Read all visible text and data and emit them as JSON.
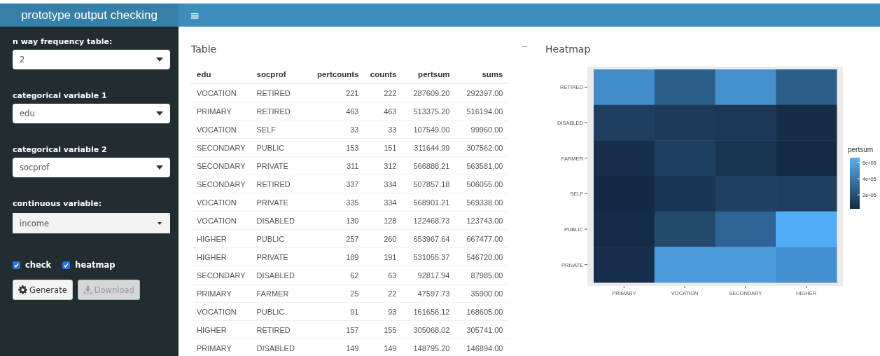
{
  "header": {
    "title": "prototype output checking",
    "menu_glyph": "≡"
  },
  "sidebar": {
    "fields": [
      {
        "label": "n way frequency table:",
        "value": "2",
        "kind": "select"
      },
      {
        "label": "categorical variable 1",
        "value": "edu",
        "kind": "select"
      },
      {
        "label": "categorical variable 2",
        "value": "socprof",
        "kind": "select"
      },
      {
        "label": "continuous variable:",
        "value": "income",
        "kind": "selectize"
      }
    ],
    "checkboxes": [
      {
        "label": "check",
        "checked": true
      },
      {
        "label": "heatmap",
        "checked": true
      }
    ],
    "buttons": [
      {
        "label": "Generate",
        "kind": "generate",
        "disabled": false
      },
      {
        "label": "Download",
        "kind": "download",
        "disabled": true
      }
    ]
  },
  "table_box": {
    "title": "Table",
    "collapse_glyph": "–",
    "columns": [
      "edu",
      "socprof",
      "pertcounts",
      "counts",
      "pertsum",
      "sums"
    ],
    "rows": [
      [
        "VOCATION",
        "RETIRED",
        "221",
        "222",
        "287609.20",
        "292397.00"
      ],
      [
        "PRIMARY",
        "RETIRED",
        "463",
        "463",
        "513375.20",
        "516194.00"
      ],
      [
        "VOCATION",
        "SELF",
        "33",
        "33",
        "107549.00",
        "99960.00"
      ],
      [
        "SECONDARY",
        "PUBLIC",
        "153",
        "151",
        "311644.99",
        "307562.00"
      ],
      [
        "SECONDARY",
        "PRIVATE",
        "311",
        "312",
        "566888.21",
        "563581.00"
      ],
      [
        "SECONDARY",
        "RETIRED",
        "337",
        "334",
        "507857.18",
        "506055.00"
      ],
      [
        "VOCATION",
        "PRIVATE",
        "335",
        "334",
        "568901.21",
        "569338.00"
      ],
      [
        "VOCATION",
        "DISABLED",
        "130",
        "128",
        "122468.73",
        "123743.00"
      ],
      [
        "HIGHER",
        "PUBLIC",
        "257",
        "260",
        "653967.64",
        "667477.00"
      ],
      [
        "HIGHER",
        "PRIVATE",
        "189",
        "191",
        "531055.37",
        "546720.00"
      ],
      [
        "SECONDARY",
        "DISABLED",
        "62",
        "63",
        "92817.94",
        "87985.00"
      ],
      [
        "PRIMARY",
        "FARMER",
        "25",
        "22",
        "47597.73",
        "35900.00"
      ],
      [
        "VOCATION",
        "PUBLIC",
        "91",
        "93",
        "161656.12",
        "168605.00"
      ],
      [
        "HIGHER",
        "RETIRED",
        "157",
        "155",
        "305068.02",
        "305741.00"
      ],
      [
        "PRIMARY",
        "DISABLED",
        "149",
        "149",
        "148795.20",
        "146894.00"
      ]
    ]
  },
  "heatmap_box": {
    "title": "Heatmap",
    "x_labels": [
      "PRIMARY",
      "VOCATION",
      "SECONDARY",
      "HIGHER"
    ],
    "y_labels": [
      "RETIRED",
      "DISABLED",
      "FARMER",
      "SELF",
      "PUBLIC",
      "PRIVATE"
    ],
    "cells": [
      [
        {
          "color": "#438dcb"
        },
        {
          "color": "#2c5e8a"
        },
        {
          "color": "#4590cf"
        },
        {
          "color": "#2c5e8a"
        }
      ],
      [
        {
          "color": "#203f60"
        },
        {
          "color": "#1c3a58"
        },
        {
          "color": "#1b3755"
        },
        {
          "color": "#152d47"
        }
      ],
      [
        {
          "color": "#172f4b"
        },
        {
          "color": "#1e3f60"
        },
        {
          "color": "#19344f"
        },
        {
          "color": "#142b45"
        }
      ],
      [
        {
          "color": "#132a44"
        },
        {
          "color": "#1a3654"
        },
        {
          "color": "#213f62"
        },
        {
          "color": "#1f3f60"
        }
      ],
      [
        {
          "color": "#142c47"
        },
        {
          "color": "#234a6d"
        },
        {
          "color": "#2e6395"
        },
        {
          "color": "#51adf5"
        }
      ],
      [
        {
          "color": "#172f4c"
        },
        {
          "color": "#4a9cdc"
        },
        {
          "color": "#4a9cdc"
        },
        {
          "color": "#438fd0"
        }
      ]
    ],
    "legend": {
      "title": "pertsum",
      "ticks": [
        "6e+05",
        "4e+05",
        "2e+05"
      ]
    }
  }
}
